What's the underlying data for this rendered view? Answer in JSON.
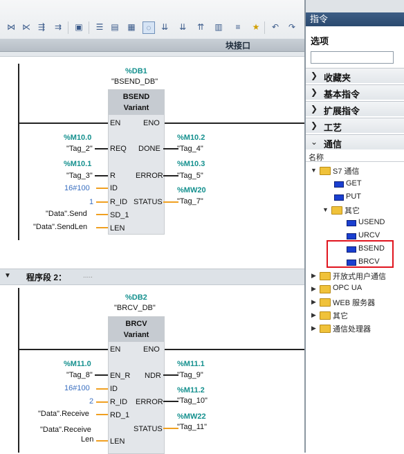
{
  "toolbar": {
    "icons": [
      "network-icon",
      "disconnect-icon",
      "ladder-insert-icon",
      "ladder-delete-icon",
      "save-icon",
      "list-icon",
      "grid-icon",
      "cross-reference-icon",
      "comment-icon",
      "download-icon",
      "download-2-icon",
      "upload-icon",
      "monitor-icon",
      "star-icon",
      "undo-icon",
      "redo-icon"
    ]
  },
  "interface_label": "块接口",
  "networks": {
    "segment2": {
      "label": "程序段 2：",
      "dots": "....."
    },
    "bsend": {
      "db": "%DB1",
      "db_name": "\"BSEND_DB\"",
      "name": "BSEND",
      "variant": "Variant",
      "in_pins": [
        "EN",
        "REQ",
        "R",
        "ID",
        "R_ID",
        "SD_1",
        "LEN"
      ],
      "out_pins": [
        "ENO",
        "DONE",
        "ERROR",
        "STATUS"
      ],
      "req_addr": "%M10.0",
      "req_tag": "\"Tag_2\"",
      "r_addr": "%M10.1",
      "r_tag": "\"Tag_3\"",
      "id_val": "16#100",
      "r_id_val": "1",
      "sd1_val": "\"Data\".Send",
      "len_val": "\"Data\".SendLen",
      "done_addr": "%M10.2",
      "done_tag": "\"Tag_4\"",
      "error_addr": "%M10.3",
      "error_tag": "\"Tag_5\"",
      "status_addr": "%MW20",
      "status_tag": "\"Tag_7\""
    },
    "brcv": {
      "db": "%DB2",
      "db_name": "\"BRCV_DB\"",
      "name": "BRCV",
      "variant": "Variant",
      "in_pins": [
        "EN",
        "EN_R",
        "ID",
        "R_ID",
        "RD_1",
        "LEN"
      ],
      "out_pins": [
        "ENO",
        "NDR",
        "ERROR",
        "STATUS"
      ],
      "enr_addr": "%M11.0",
      "enr_tag": "\"Tag_8\"",
      "id_val": "16#100",
      "r_id_val": "2",
      "rd1_val": "\"Data\".Receive",
      "len_val1": "\"Data\".Receive",
      "len_val2": "Len",
      "ndr_addr": "%M11.1",
      "ndr_tag": "\"Tag_9\"",
      "error_addr": "%M11.2",
      "error_tag": "\"Tag_10\"",
      "status_addr": "%MW22",
      "status_tag": "\"Tag_11\""
    }
  },
  "panel": {
    "title": "指令",
    "options": "选项",
    "categories": [
      "收藏夹",
      "基本指令",
      "扩展指令",
      "工艺",
      "通信"
    ],
    "name_header": "名称",
    "tree": {
      "s7": "S7 通信",
      "get": "GET",
      "put": "PUT",
      "other": "其它",
      "usend": "USEND",
      "urcv": "URCV",
      "bsend": "BSEND",
      "brcv": "BRCV",
      "open_user": "开放式用户通信",
      "opc_ua": "OPC UA",
      "web": "WEB 服务器",
      "other2": "其它",
      "cp": "通信处理器"
    },
    "highlight_color": "#e0141e"
  }
}
